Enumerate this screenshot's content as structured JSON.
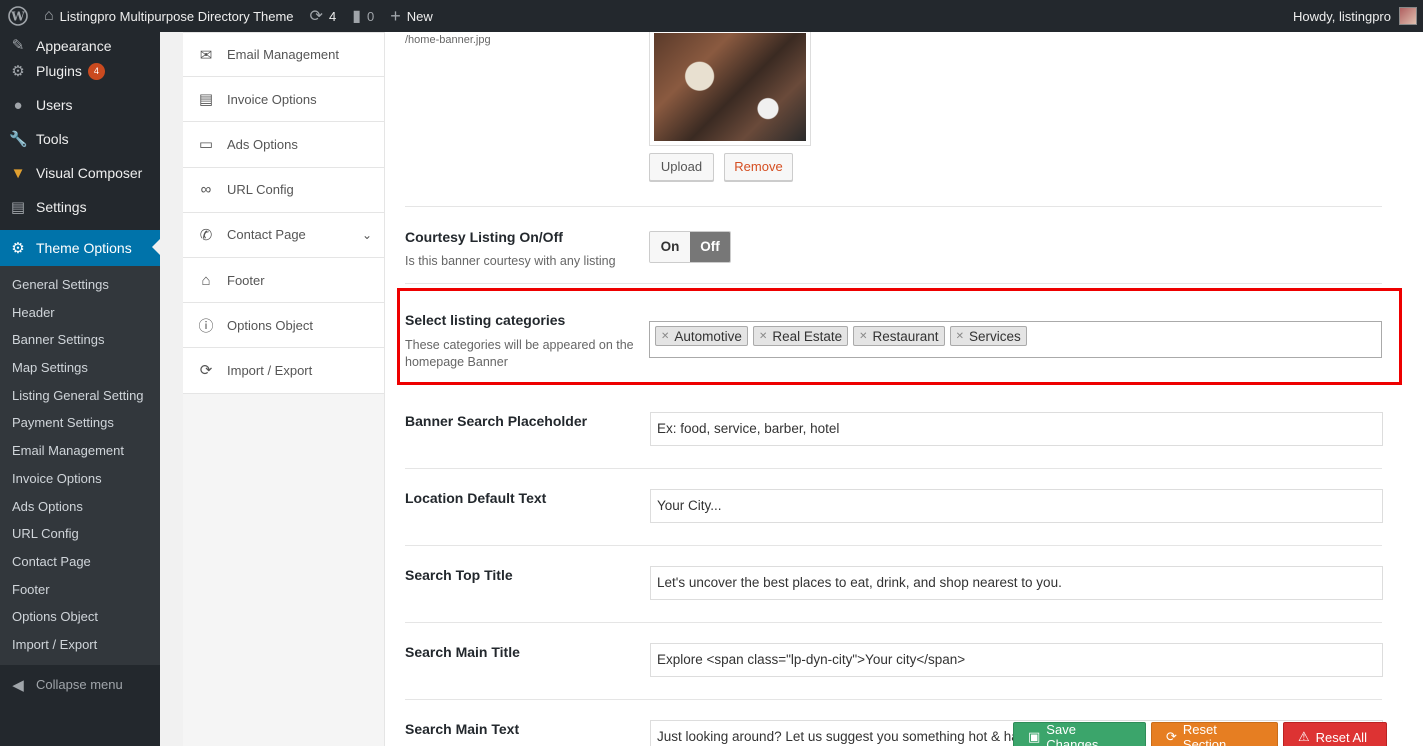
{
  "adminbar": {
    "site_name": "Listingpro Multipurpose Directory Theme",
    "updates_count": "4",
    "comments_count": "0",
    "new_label": "New",
    "howdy": "Howdy, listingpro"
  },
  "admin_menu": {
    "items": [
      {
        "label": "Appearance",
        "icon": "paintbrush-icon"
      },
      {
        "label": "Plugins",
        "icon": "plugin-icon",
        "badge": "4"
      },
      {
        "label": "Users",
        "icon": "users-icon"
      },
      {
        "label": "Tools",
        "icon": "wrench-icon"
      },
      {
        "label": "Visual Composer",
        "icon": "visual-composer-icon"
      },
      {
        "label": "Settings",
        "icon": "settings-icon"
      },
      {
        "label": "Theme Options",
        "icon": "gear-icon"
      }
    ],
    "submenu": [
      "General Settings",
      "Header",
      "Banner Settings",
      "Map Settings",
      "Listing General Setting",
      "Payment Settings",
      "Email Management",
      "Invoice Options",
      "Ads Options",
      "URL Config",
      "Contact Page",
      "Footer",
      "Options Object",
      "Import / Export"
    ],
    "collapse_label": "Collapse menu"
  },
  "theme_nav": {
    "items": [
      {
        "label": "Email Management",
        "icon": "envelope-icon"
      },
      {
        "label": "Invoice Options",
        "icon": "clipboard-icon"
      },
      {
        "label": "Ads Options",
        "icon": "monitor-icon"
      },
      {
        "label": "URL Config",
        "icon": "link-icon"
      },
      {
        "label": "Contact Page",
        "icon": "phone-icon"
      },
      {
        "label": "Footer",
        "icon": "home-icon"
      },
      {
        "label": "Options Object",
        "icon": "info-icon"
      },
      {
        "label": "Import / Export",
        "icon": "refresh-icon"
      }
    ]
  },
  "banner_image": {
    "path": "/home-banner.jpg",
    "upload_label": "Upload",
    "remove_label": "Remove"
  },
  "courtesy": {
    "label": "Courtesy Listing On/Off",
    "desc": "Is this banner courtesy with any listing",
    "on": "On",
    "off": "Off"
  },
  "categories": {
    "label": "Select listing categories",
    "desc": "These categories will be appeared on the homepage Banner",
    "tags": [
      "Automotive",
      "Real Estate",
      "Restaurant",
      "Services"
    ]
  },
  "fields": {
    "search_placeholder": {
      "label": "Banner Search Placeholder",
      "value": "Ex: food, service, barber, hotel"
    },
    "location_default": {
      "label": "Location Default Text",
      "value": "Your City..."
    },
    "search_top_title": {
      "label": "Search Top Title",
      "value": "Let's uncover the best places to eat, drink, and shop nearest to you."
    },
    "search_main_title": {
      "label": "Search Main Title",
      "value": "Explore <span class=\"lp-dyn-city\">Your city</span>"
    },
    "search_main_text": {
      "label": "Search Main Text",
      "value": "Just looking around? Let us suggest you something hot & happening!"
    }
  },
  "actions": {
    "save": "Save Changes",
    "reset_section": "Reset Section",
    "reset_all": "Reset All"
  },
  "colors": {
    "admin_dark": "#23282d",
    "admin_blue": "#0073aa",
    "highlight_red": "#e00000",
    "save_green": "#3ba56b",
    "reset_orange": "#e67e22",
    "reset_red": "#dd3333"
  }
}
